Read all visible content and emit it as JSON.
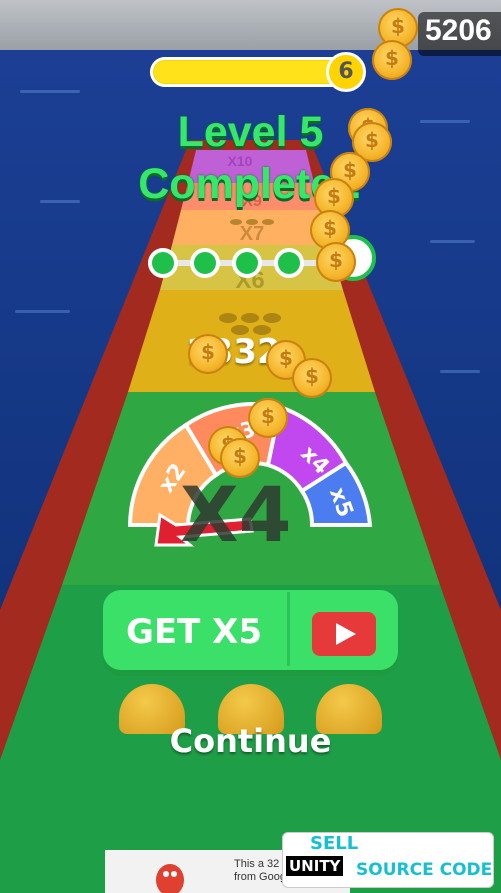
{
  "hud": {
    "coins": "5206",
    "level_badge": "6"
  },
  "title": {
    "line1": "Level 5",
    "line2": "Complete!!"
  },
  "track": {
    "row_labels": [
      "X10",
      "X9",
      "X7",
      "X6"
    ]
  },
  "score": "1332",
  "gauge": {
    "center_label": "X4",
    "segments": [
      "x2",
      "x3",
      "x4",
      "x5"
    ],
    "colors": {
      "x2": "#ffb064",
      "x3": "#ff8a5e",
      "x4": "#c048ee",
      "x5": "#4b7df0"
    }
  },
  "buttons": {
    "get": "GET X5",
    "continue": "Continue"
  },
  "ad": {
    "text_line1": "This a 32",
    "text_line2": "from Google Admob"
  },
  "watermark": {
    "sell": "SELL",
    "unity": "UNITY",
    "source": "SOURCE CODE"
  },
  "colors": {
    "accent_green": "#36e86a",
    "button_green": "#3be068",
    "play_red": "#e63a3a",
    "coin_gold": "#f5b62b"
  }
}
